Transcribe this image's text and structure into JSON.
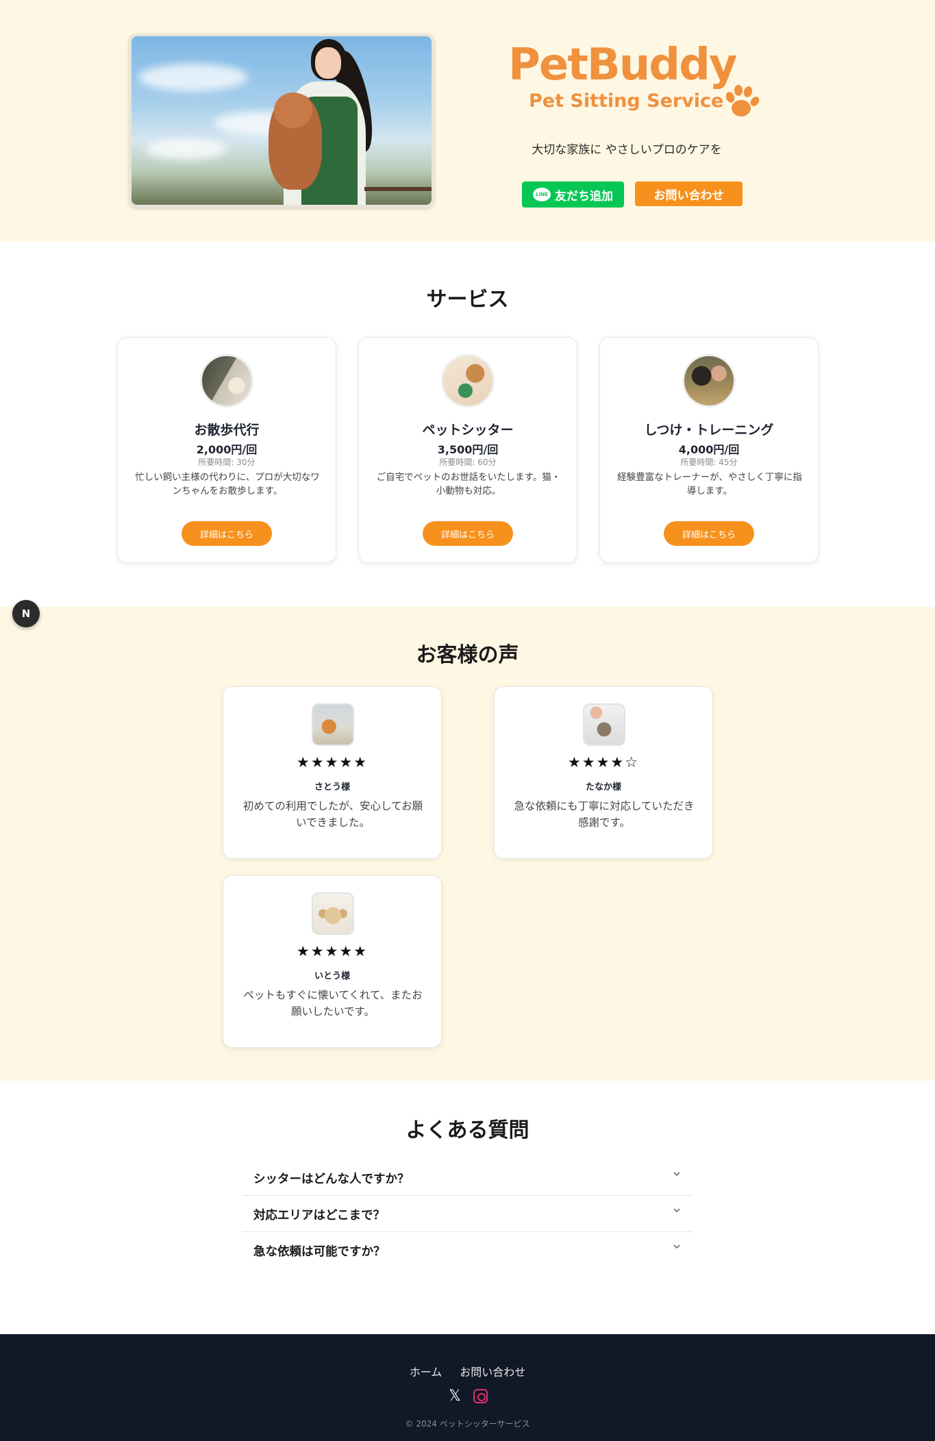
{
  "hero": {
    "logo_title": "PetBuddy",
    "logo_subtitle": "Pet Sitting Service",
    "tagline": "大切な家族に やさしいプロのケアを",
    "line_button": "友だち追加",
    "line_icon_text": "LINE",
    "contact_button": "お問い合わせ",
    "brand_color": "#f0913e",
    "accent_color": "#f7911d",
    "line_color": "#06c755"
  },
  "services": {
    "title": "サービス",
    "items": [
      {
        "name": "お散歩代行",
        "price": "2,000円/回",
        "time": "所要時間: 30分",
        "desc": "忙しい飼い主様の代わりに、プロが大切なワンちゃんをお散歩します。",
        "button": "詳細はこちら"
      },
      {
        "name": "ペットシッター",
        "price": "3,500円/回",
        "time": "所要時間: 60分",
        "desc": "ご自宅でペットのお世話をいたします。猫・小動物も対応。",
        "button": "詳細はこちら"
      },
      {
        "name": "しつけ・トレーニング",
        "price": "4,000円/回",
        "time": "所要時間: 45分",
        "desc": "経験豊富なトレーナーが、やさしく丁寧に指導します。",
        "button": "詳細はこちら"
      }
    ]
  },
  "badge": {
    "letter": "N"
  },
  "reviews": {
    "title": "お客様の声",
    "items": [
      {
        "stars": "★★★★★",
        "name": "さとう様",
        "text": "初めての利用でしたが、安心してお願いできました。"
      },
      {
        "stars": "★★★★☆",
        "name": "たなか様",
        "text": "急な依頼にも丁寧に対応していただき感謝です。"
      },
      {
        "stars": "★★★★★",
        "name": "いとう様",
        "text": "ペットもすぐに懐いてくれて、またお願いしたいです。"
      }
    ]
  },
  "faq": {
    "title": "よくある質問",
    "items": [
      {
        "question": "シッターはどんな人ですか？"
      },
      {
        "question": "対応エリアはどこまで？"
      },
      {
        "question": "急な依頼は可能ですか？"
      }
    ]
  },
  "footer": {
    "links": [
      "ホーム",
      "お問い合わせ"
    ],
    "x_icon": "𝕏",
    "copyright": "© 2024 ペットシッターサービス"
  }
}
